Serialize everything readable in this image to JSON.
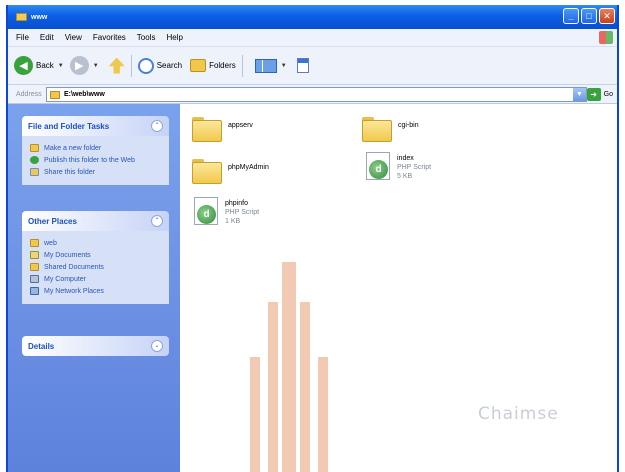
{
  "window": {
    "title": "www"
  },
  "menu": [
    "File",
    "Edit",
    "View",
    "Favorites",
    "Tools",
    "Help"
  ],
  "toolbar": {
    "back": "Back",
    "search": "Search",
    "folders": "Folders"
  },
  "address": {
    "label": "Address",
    "path": "E:\\web\\www",
    "go": "Go"
  },
  "task_pane": {
    "file_folder_tasks": {
      "title": "File and Folder Tasks",
      "items": [
        "Make a new folder",
        "Publish this folder to the Web",
        "Share this folder"
      ]
    },
    "other_places": {
      "title": "Other Places",
      "items": [
        "web",
        "My Documents",
        "Shared Documents",
        "My Computer",
        "My Network Places"
      ]
    },
    "details": {
      "title": "Details"
    }
  },
  "files": [
    {
      "name": "appserv",
      "kind": "folder"
    },
    {
      "name": "cgi-bin",
      "kind": "folder"
    },
    {
      "name": "phpMyAdmin",
      "kind": "folder"
    },
    {
      "name": "index",
      "type": "PHP Script",
      "size": "5 KB"
    },
    {
      "name": "phpinfo",
      "type": "PHP Script",
      "size": "1 KB"
    }
  ],
  "watermark": {
    "text": "Chaimse"
  },
  "icons": {
    "folder": "folder-icon",
    "php": "php-file-icon"
  }
}
